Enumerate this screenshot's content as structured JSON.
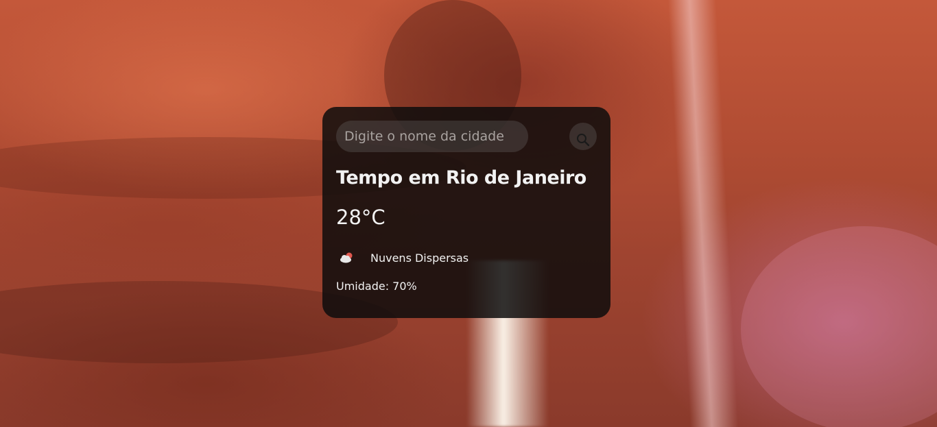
{
  "search": {
    "placeholder": "Digite o nome da cidade",
    "value": ""
  },
  "weather": {
    "title": "Tempo em Rio de Janeiro",
    "temperature": "28°C",
    "description": "Nuvens Dispersas",
    "humidity": "Umidade: 70%",
    "icon": "scattered-clouds-icon"
  },
  "icons": {
    "search": "search-icon"
  },
  "colors": {
    "card_background": "#0c0c0c",
    "text": "#f2f2f2",
    "placeholder": "#a9a3a0"
  }
}
